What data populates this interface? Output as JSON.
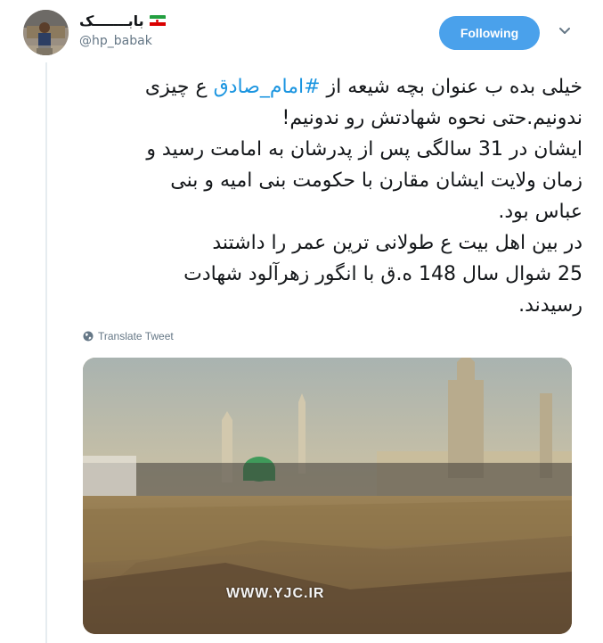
{
  "author": {
    "display_name": "بابـــــــک",
    "handle": "@hp_babak",
    "flag_icon": "iran-flag-icon"
  },
  "follow_button": {
    "label": "Following",
    "color": "#4aa1eb"
  },
  "caret_icon": "chevron-down-icon",
  "tweet": {
    "line1_pre": "خیلی بده ب عنوان بچه شیعه از ",
    "hashtag": "#امام_صادق",
    "line1_post": " ع چیزی",
    "lines": [
      "ندونیم.حتی نحوه شهادتش رو ندونیم!",
      "ایشان در 31 سالگی پس از پدرشان به امامت رسید و",
      "زمان ولایت ایشان مقارن با حکومت بنی امیه و بنی",
      "عباس بود.",
      "در بین اهل بیت ع طولانی ترین عمر را داشتند",
      "25 شوال سال 148 ه.ق با انگور زهرآلود شهادت",
      "رسیدند."
    ],
    "hashtag_color": "#1b95e0"
  },
  "translate": {
    "label": "Translate Tweet",
    "icon": "globe-icon"
  },
  "media": {
    "watermark": "WWW.YJC.IR"
  }
}
